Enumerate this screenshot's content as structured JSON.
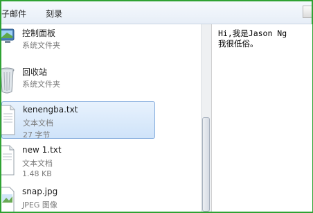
{
  "menubar": {
    "items": [
      {
        "label": "子邮件"
      },
      {
        "label": "刻录"
      }
    ]
  },
  "files": [
    {
      "name": "控制面板",
      "line1": "系统文件夹",
      "line2": "",
      "icon": "control-panel-icon",
      "selected": false
    },
    {
      "name": "回收站",
      "line1": "系统文件夹",
      "line2": "",
      "icon": "recycle-bin-icon",
      "selected": false
    },
    {
      "name": "kenengba.txt",
      "line1": "文本文档",
      "line2": "27 字节",
      "icon": "text-file-icon",
      "selected": true
    },
    {
      "name": "new 1.txt",
      "line1": "文本文档",
      "line2": "1.48 KB",
      "icon": "text-file-icon",
      "selected": false
    },
    {
      "name": "snap.jpg",
      "line1": "JPEG 图像",
      "line2": "",
      "icon": "image-file-icon",
      "selected": false
    }
  ],
  "preview": {
    "lines": [
      "Hi,我是Jason Ng",
      "我很低俗。"
    ]
  },
  "colors": {
    "frame_border": "#2fa233",
    "selection_fill": "#cfe3f9",
    "selection_border": "#84acdd"
  }
}
